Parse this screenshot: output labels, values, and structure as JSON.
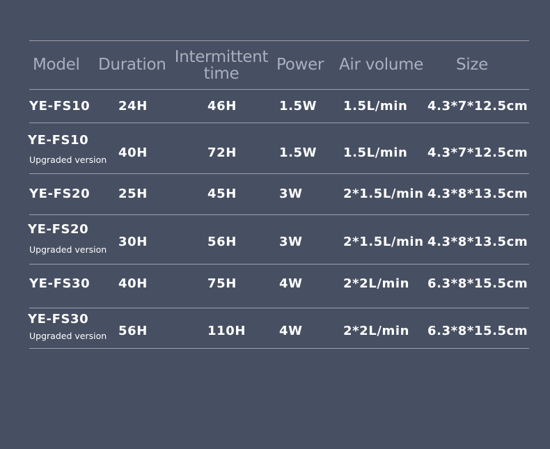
{
  "table": {
    "headers": {
      "model": "Model",
      "duration": "Duration",
      "intermittent_line1": "Intermittent",
      "intermittent_line2": "time",
      "power": "Power",
      "air_volume": "Air volume",
      "size": "Size"
    },
    "rows": [
      {
        "model": "YE-FS10",
        "sub": "",
        "duration": "24H",
        "intermittent": "46H",
        "power": "1.5W",
        "air": "1.5L/min",
        "size": "4.3*7*12.5cm"
      },
      {
        "model": "YE-FS10",
        "sub": "Upgraded version",
        "duration": "40H",
        "intermittent": "72H",
        "power": "1.5W",
        "air": "1.5L/min",
        "size": "4.3*7*12.5cm"
      },
      {
        "model": "YE-FS20",
        "sub": "",
        "duration": "25H",
        "intermittent": "45H",
        "power": "3W",
        "air": "2*1.5L/min",
        "size": "4.3*8*13.5cm"
      },
      {
        "model": "YE-FS20",
        "sub": "Upgraded version",
        "duration": "30H",
        "intermittent": "56H",
        "power": "3W",
        "air": "2*1.5L/min",
        "size": "4.3*8*13.5cm"
      },
      {
        "model": "YE-FS30",
        "sub": "",
        "duration": "40H",
        "intermittent": "75H",
        "power": "4W",
        "air": "2*2L/min",
        "size": "6.3*8*15.5cm"
      },
      {
        "model": "YE-FS30",
        "sub": "Upgraded version",
        "duration": "56H",
        "intermittent": "110H",
        "power": "4W",
        "air": "2*2L/min",
        "size": "6.3*8*15.5cm"
      }
    ]
  }
}
